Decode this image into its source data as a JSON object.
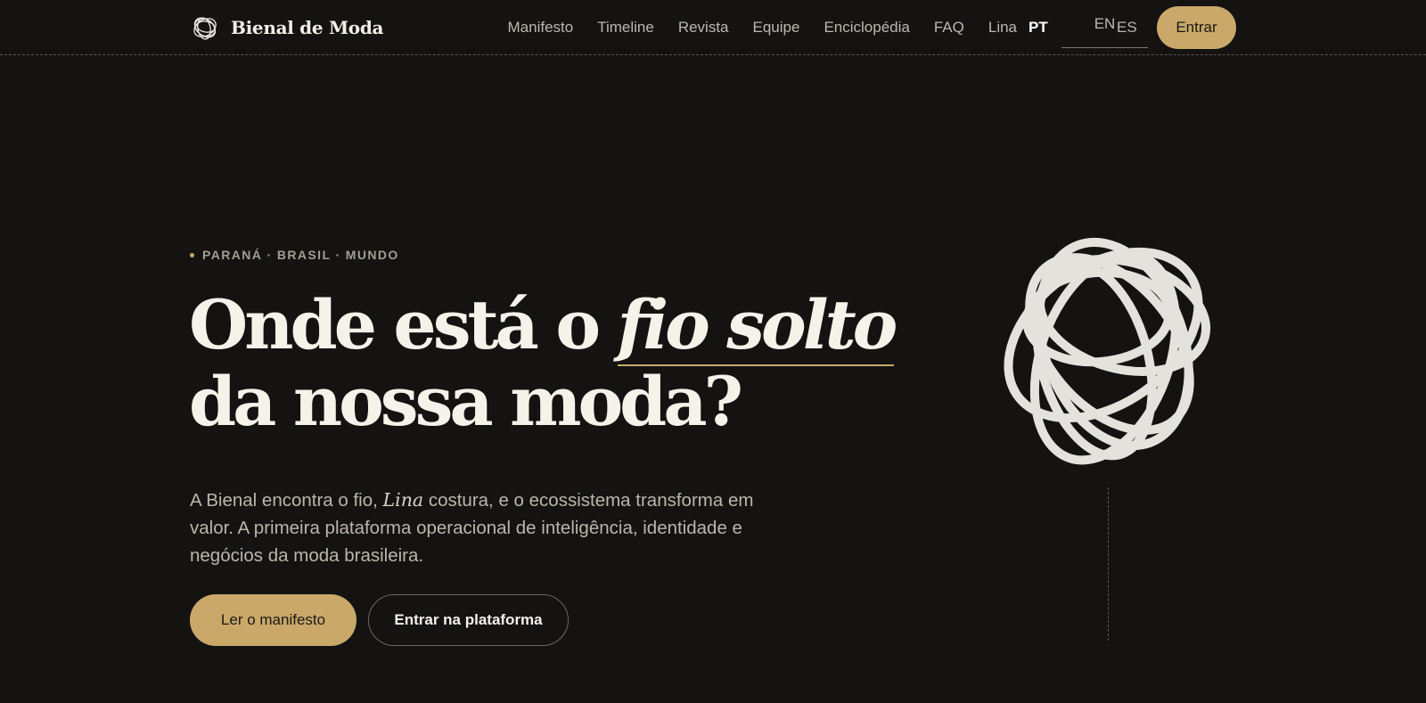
{
  "header": {
    "brand": "Bienal de Moda",
    "nav": [
      "Manifesto",
      "Timeline",
      "Revista",
      "Equipe",
      "Enciclopédia",
      "FAQ",
      "Lina"
    ],
    "languages": {
      "pt": "PT",
      "en": "EN",
      "es": "ES",
      "active": "PT"
    },
    "login_label": "Entrar"
  },
  "hero": {
    "eyebrow": "PARANÁ · BRASIL · MUNDO",
    "headline_part1": "Onde está o ",
    "headline_emphasis": "fio solto",
    "headline_line2": "da nossa moda?",
    "lead_part1": "A Bienal encontra o fio, ",
    "lead_emphasis": "Lina",
    "lead_part2": " costura, e o ecossistema transforma em valor. A primeira plataforma operacional de inteligência, identidade e negócios da moda brasileira.",
    "primary_cta": "Ler o manifesto",
    "secondary_cta": "Entrar na plataforma"
  },
  "colors": {
    "background": "#141312",
    "accent_gold": "#c9a86a",
    "text": "#f6f2ea",
    "muted": "#bcb6aa"
  },
  "icons": {
    "brand": "thread-knot-icon",
    "hero": "thread-knot-illustration"
  }
}
